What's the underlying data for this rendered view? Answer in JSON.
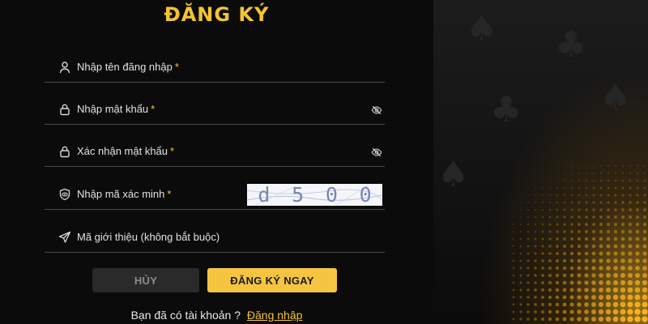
{
  "title": "ĐĂNG KÝ",
  "fields": {
    "username": {
      "label": "Nhập tên đăng nhập",
      "required_mark": "*"
    },
    "password": {
      "label": "Nhập mật khẩu",
      "required_mark": "*"
    },
    "confirm_password": {
      "label": "Xác nhận mật khẩu",
      "required_mark": "*"
    },
    "captcha": {
      "label": "Nhập mã xác minh",
      "required_mark": "*",
      "captcha_chars": [
        "d",
        "5",
        "0",
        "0"
      ]
    },
    "referral": {
      "label": "Mã giới thiệu (không bắt buộc)"
    }
  },
  "buttons": {
    "cancel": "HỦY",
    "register": "ĐĂNG KÝ NGAY"
  },
  "footer": {
    "question": "Bạn đã có tài khoản ?",
    "login_link": "Đăng nhập"
  },
  "icons": {
    "username": "user-icon",
    "password": "lock-icon",
    "confirm_password": "lock-icon",
    "captcha": "shield-eye-icon",
    "referral": "send-icon",
    "toggle_visibility": "eye-off-icon"
  },
  "colors": {
    "accent": "#f4c430",
    "background": "#0b0b0b",
    "field_border": "#4a4a4a",
    "cancel_bg": "#2a2a2a",
    "register_bg": "#f5c542"
  }
}
